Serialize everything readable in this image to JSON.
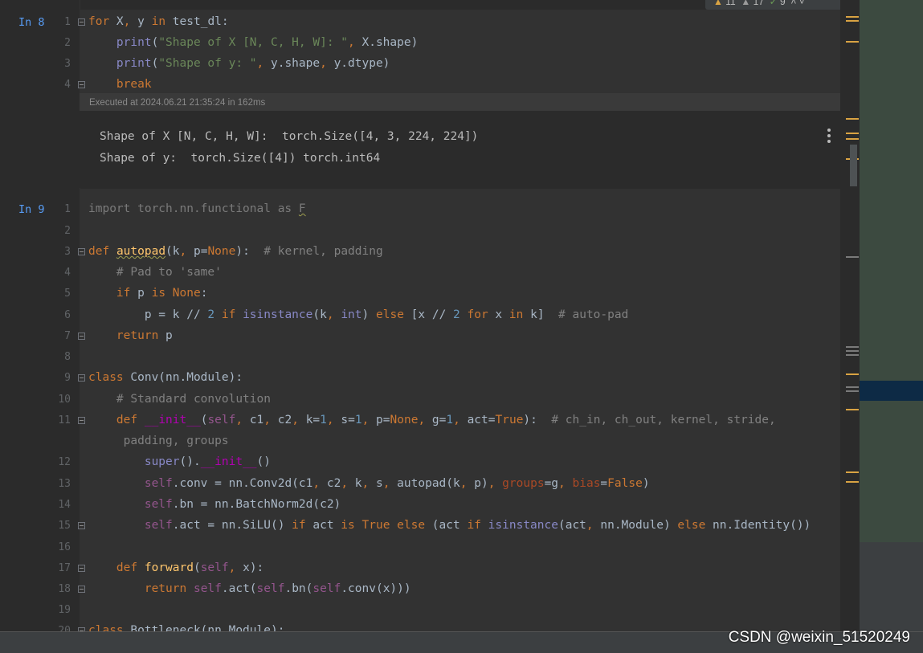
{
  "inspections": {
    "warn": "11",
    "weak": "17",
    "typo": "9"
  },
  "cell8": {
    "prompt": "In 8",
    "lines": [
      {
        "n": "1",
        "text": "for X, y in test_dl:"
      },
      {
        "n": "2",
        "text": "    print(\"Shape of X [N, C, H, W]: \", X.shape)"
      },
      {
        "n": "3",
        "text": "    print(\"Shape of y: \", y.shape, y.dtype)"
      },
      {
        "n": "4",
        "text": "    break"
      }
    ],
    "executed": "Executed at 2024.06.21 21:35:24 in 162ms",
    "output": [
      "Shape of X [N, C, H, W]:  torch.Size([4, 3, 224, 224])",
      "Shape of y:  torch.Size([4]) torch.int64"
    ]
  },
  "cell9": {
    "prompt": "In 9",
    "lines": [
      {
        "n": "1",
        "text": "import torch.nn.functional as F"
      },
      {
        "n": "2",
        "text": ""
      },
      {
        "n": "3",
        "text": "def autopad(k, p=None):  # kernel, padding"
      },
      {
        "n": "4",
        "text": "    # Pad to 'same'"
      },
      {
        "n": "5",
        "text": "    if p is None:"
      },
      {
        "n": "6",
        "text": "        p = k // 2 if isinstance(k, int) else [x // 2 for x in k]  # auto-pad"
      },
      {
        "n": "7",
        "text": "    return p"
      },
      {
        "n": "8",
        "text": ""
      },
      {
        "n": "9",
        "text": "class Conv(nn.Module):"
      },
      {
        "n": "10",
        "text": "    # Standard convolution"
      },
      {
        "n": "11",
        "text": "    def __init__(self, c1, c2, k=1, s=1, p=None, g=1, act=True):  # ch_in, ch_out, kernel, stride,"
      },
      {
        "n": "",
        "text": "     padding, groups"
      },
      {
        "n": "12",
        "text": "        super().__init__()"
      },
      {
        "n": "13",
        "text": "        self.conv = nn.Conv2d(c1, c2, k, s, autopad(k, p), groups=g, bias=False)"
      },
      {
        "n": "14",
        "text": "        self.bn = nn.BatchNorm2d(c2)"
      },
      {
        "n": "15",
        "text": "        self.act = nn.SiLU() if act is True else (act if isinstance(act, nn.Module) else nn.Identity())"
      },
      {
        "n": "16",
        "text": ""
      },
      {
        "n": "17",
        "text": "    def forward(self, x):"
      },
      {
        "n": "18",
        "text": "        return self.act(self.bn(self.conv(x)))"
      },
      {
        "n": "19",
        "text": ""
      },
      {
        "n": "20",
        "text": "class Bottleneck(nn.Module):"
      }
    ]
  },
  "watermark": "CSDN @weixin_51520249",
  "colors": {
    "accent": "#589df6",
    "marker": "#d9a343",
    "keyword": "#cc7832",
    "string": "#6a8759"
  }
}
